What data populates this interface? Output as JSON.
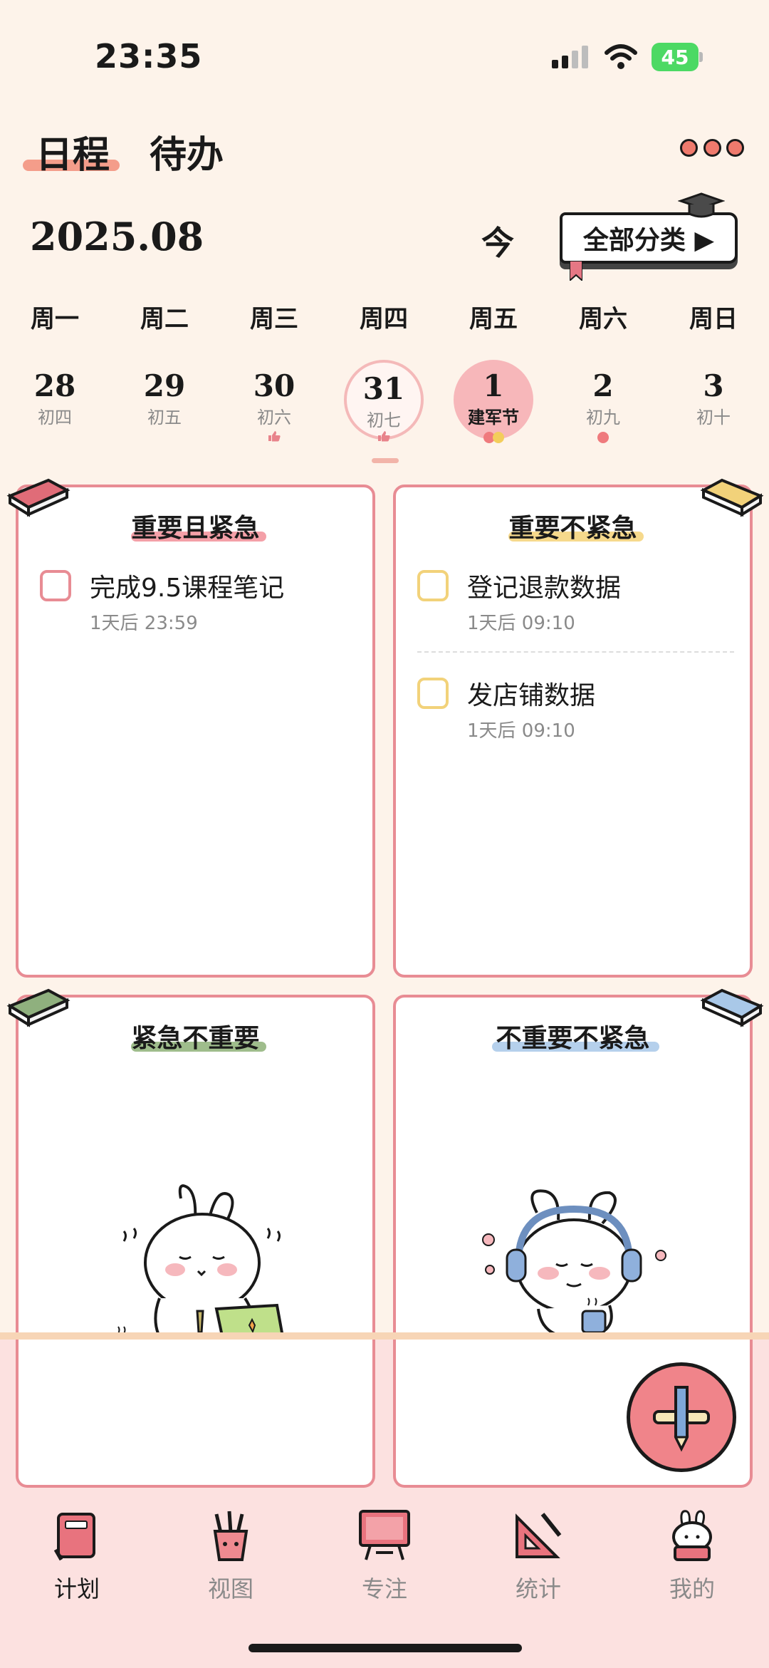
{
  "status_bar": {
    "time": "23:35",
    "battery": "45"
  },
  "header": {
    "tabs": [
      {
        "label": "日程",
        "active": true
      },
      {
        "label": "待办",
        "active": false
      }
    ],
    "more_icon": "more-dots-icon"
  },
  "calendar": {
    "month": "2025.08",
    "today_label": "今",
    "category_label": "全部分类 ▶",
    "weekdays": [
      "周一",
      "周二",
      "周三",
      "周四",
      "周五",
      "周六",
      "周日"
    ],
    "days": [
      {
        "num": "28",
        "lunar": "初四",
        "state": "normal"
      },
      {
        "num": "29",
        "lunar": "初五",
        "state": "normal"
      },
      {
        "num": "30",
        "lunar": "初六",
        "state": "normal"
      },
      {
        "num": "31",
        "lunar": "初七",
        "state": "today"
      },
      {
        "num": "1",
        "lunar": "建军节",
        "state": "selected"
      },
      {
        "num": "2",
        "lunar": "初九",
        "state": "normal"
      },
      {
        "num": "3",
        "lunar": "初十",
        "state": "normal"
      }
    ]
  },
  "quadrants": [
    {
      "title": "重要且紧急",
      "accent": "#e88c94",
      "tasks": [
        {
          "title": "完成9.5课程笔记",
          "time": "1天后 23:59"
        }
      ]
    },
    {
      "title": "重要不紧急",
      "accent": "#f2d27a",
      "tasks": [
        {
          "title": "登记退款数据",
          "time": "1天后 09:10"
        },
        {
          "title": "发店铺数据",
          "time": "1天后 09:10"
        }
      ]
    },
    {
      "title": "紧急不重要",
      "accent": "#8fb07e",
      "tasks": []
    },
    {
      "title": "不重要不紧急",
      "accent": "#a9c8e8",
      "tasks": []
    }
  ],
  "bottom_nav": [
    {
      "label": "计划",
      "icon": "planner-book-icon",
      "active": true
    },
    {
      "label": "视图",
      "icon": "pencil-cup-icon",
      "active": false
    },
    {
      "label": "专注",
      "icon": "chalkboard-icon",
      "active": false
    },
    {
      "label": "统计",
      "icon": "set-square-icon",
      "active": false
    },
    {
      "label": "我的",
      "icon": "bunny-profile-icon",
      "active": false
    }
  ]
}
